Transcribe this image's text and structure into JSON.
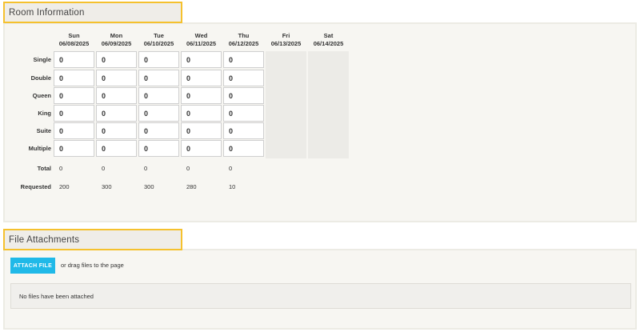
{
  "room_section": {
    "title": "Room Information",
    "days": [
      {
        "dow": "Sun",
        "date": "06/08/2025",
        "enabled": true
      },
      {
        "dow": "Mon",
        "date": "06/09/2025",
        "enabled": true
      },
      {
        "dow": "Tue",
        "date": "06/10/2025",
        "enabled": true
      },
      {
        "dow": "Wed",
        "date": "06/11/2025",
        "enabled": true
      },
      {
        "dow": "Thu",
        "date": "06/12/2025",
        "enabled": true
      },
      {
        "dow": "Fri",
        "date": "06/13/2025",
        "enabled": false
      },
      {
        "dow": "Sat",
        "date": "06/14/2025",
        "enabled": false
      }
    ],
    "room_types": [
      {
        "label": "Single",
        "values": [
          "0",
          "0",
          "0",
          "0",
          "0"
        ]
      },
      {
        "label": "Double",
        "values": [
          "0",
          "0",
          "0",
          "0",
          "0"
        ]
      },
      {
        "label": "Queen",
        "values": [
          "0",
          "0",
          "0",
          "0",
          "0"
        ]
      },
      {
        "label": "King",
        "values": [
          "0",
          "0",
          "0",
          "0",
          "0"
        ]
      },
      {
        "label": "Suite",
        "values": [
          "0",
          "0",
          "0",
          "0",
          "0"
        ]
      },
      {
        "label": "Multiple",
        "values": [
          "0",
          "0",
          "0",
          "0",
          "0"
        ]
      }
    ],
    "total": {
      "label": "Total",
      "values": [
        "0",
        "0",
        "0",
        "0",
        "0"
      ]
    },
    "requested": {
      "label": "Requested",
      "values": [
        "200",
        "300",
        "300",
        "280",
        "10"
      ]
    }
  },
  "files_section": {
    "title": "File Attachments",
    "attach_button": "ATTACH FILE",
    "drag_hint": "or drag files to the page",
    "empty_message": "No files have been attached"
  }
}
